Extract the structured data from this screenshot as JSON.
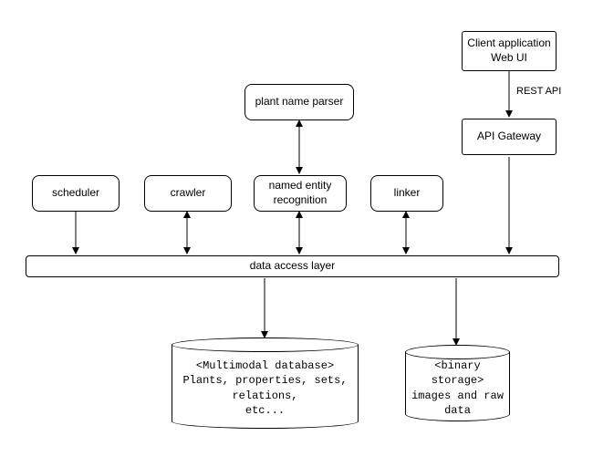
{
  "nodes": {
    "client": {
      "line1": "Client application",
      "line2": "Web UI"
    },
    "api_gateway": "API Gateway",
    "parser": "plant name parser",
    "scheduler": "scheduler",
    "crawler": "crawler",
    "ner": "named entity recognition",
    "linker": "linker",
    "dal": "data access layer"
  },
  "edges": {
    "rest_api": "REST API"
  },
  "storage": {
    "multimodal": {
      "tag": "<Multimodal database>",
      "desc": "Plants, properties, sets,\nrelations,\netc..."
    },
    "binary": {
      "tag": "<binary storage>",
      "desc": "images and raw\ndata"
    }
  }
}
